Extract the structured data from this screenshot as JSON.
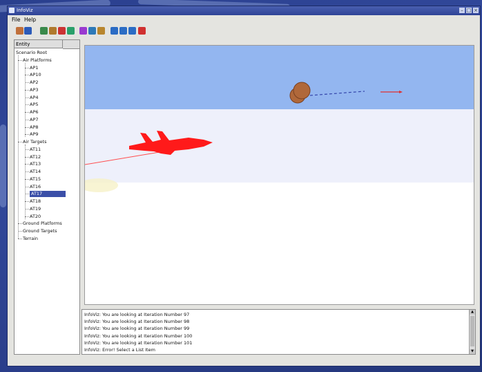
{
  "window": {
    "title": "InfoViz"
  },
  "menu": {
    "file": "File",
    "help": "Help"
  },
  "toolbar": {
    "buttons": [
      {
        "name": "print-icon",
        "color": "#c0703a"
      },
      {
        "name": "book-icon",
        "color": "#2c5bb8"
      },
      {
        "name": "globe-settings-icon",
        "color": "#3a8a4a"
      },
      {
        "name": "wrench-icon",
        "color": "#b07a2c"
      },
      {
        "name": "rocket-icon",
        "color": "#cc3333"
      },
      {
        "name": "earth-icon",
        "color": "#2aa06a"
      },
      {
        "name": "grid-icon",
        "color": "#9a3ad0"
      },
      {
        "name": "save-icon",
        "color": "#2e7ab8"
      },
      {
        "name": "tools-icon",
        "color": "#b8862e"
      },
      {
        "name": "play-icon",
        "color": "#2b6cc4"
      },
      {
        "name": "stop-icon",
        "color": "#2b6cc4"
      },
      {
        "name": "pause-icon",
        "color": "#2b6cc4"
      },
      {
        "name": "reset-icon",
        "color": "#d03030"
      }
    ]
  },
  "tree": {
    "header": "Entity",
    "root": "Scenario Root",
    "air_platforms": {
      "label": "Air Platforms",
      "items": [
        "AP1",
        "AP10",
        "AP2",
        "AP3",
        "AP4",
        "AP5",
        "AP6",
        "AP7",
        "AP8",
        "AP9"
      ]
    },
    "air_targets": {
      "label": "Air Targets",
      "items": [
        "AT11",
        "AT12",
        "AT13",
        "AT14",
        "AT15",
        "AT16",
        "AT17",
        "AT18",
        "AT19",
        "AT20"
      ],
      "selected": "AT17"
    },
    "ground_platforms": "Ground Platforms",
    "ground_targets": "Ground Targets",
    "terrain": "Terrain"
  },
  "log": {
    "lines": [
      "InfoViz: You are looking at Iteration Number 97",
      "InfoViz: You are looking at Iteration Number 98",
      "InfoViz: You are looking at Iteration Number 99",
      "InfoViz: You are looking at Iteration Number 100",
      "InfoViz: You are looking at Iteration Number 101",
      "InfoViz: Error! Select a List Item"
    ]
  },
  "scene": {
    "sky_color": "#93b6f0",
    "band_color": "#eef0fb",
    "ground_color": "#ffffff",
    "jet_color": "#ff1a1a",
    "sphere_color": "#b0683a"
  }
}
